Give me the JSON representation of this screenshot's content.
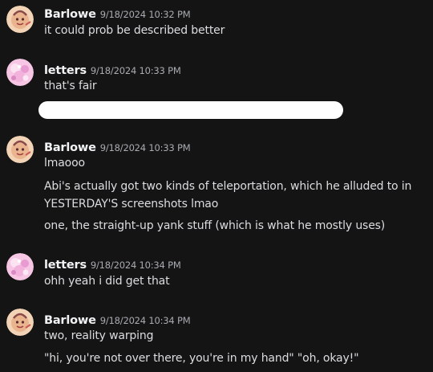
{
  "messages": [
    {
      "author": "Barlowe",
      "time": "9/18/2024 10:32 PM",
      "avatar_icon": "barlowe-avatar",
      "lines": [
        "it could prob be described better"
      ]
    },
    {
      "author": "letters",
      "time": "9/18/2024 10:33 PM",
      "avatar_icon": "letters-avatar",
      "lines": [
        "that's fair"
      ]
    },
    {
      "author": "Barlowe",
      "time": "9/18/2024 10:33 PM",
      "avatar_icon": "barlowe-avatar",
      "lines": [
        "lmaooo",
        "Abi's actually got two kinds of teleportation, which he alluded to in",
        "YESTERDAY'S screenshots lmao",
        "one, the straight-up yank stuff (which is what he mostly uses)"
      ]
    },
    {
      "author": "letters",
      "time": "9/18/2024 10:34 PM",
      "avatar_icon": "letters-avatar",
      "lines": [
        "ohh yeah i did get that"
      ]
    },
    {
      "author": "Barlowe",
      "time": "9/18/2024 10:34 PM",
      "avatar_icon": "barlowe-avatar",
      "lines": [
        "two, reality warping",
        "\"hi, you're not over there, you're in my hand\" \"oh, okay!\""
      ]
    }
  ],
  "colors": {
    "background": "#141414",
    "author": "#f2f3f5",
    "timestamp": "#a9abb2",
    "text": "#dcdde0",
    "redaction": "#ffffff"
  }
}
